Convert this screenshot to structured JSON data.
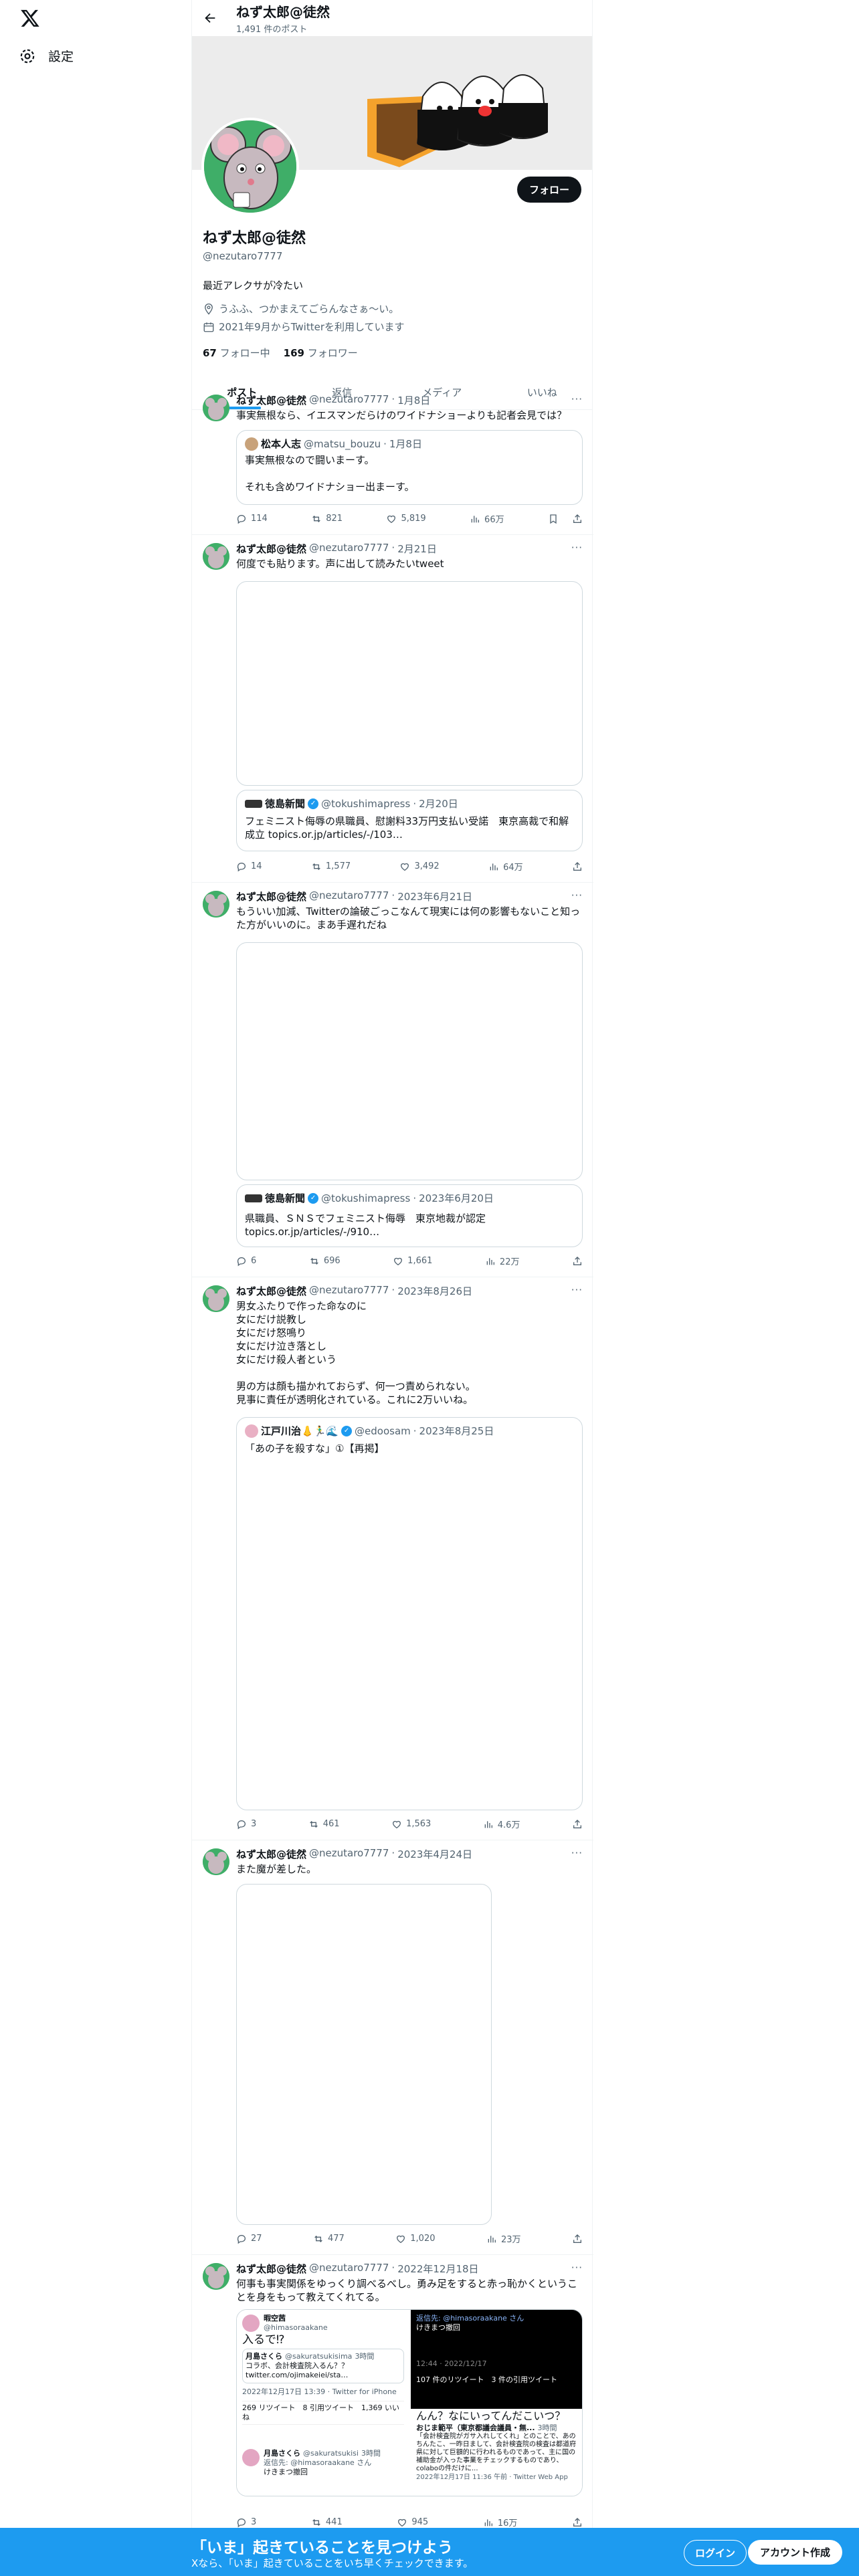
{
  "nav": {
    "settings_label": "設定"
  },
  "topbar": {
    "name": "ねず太郎@徒然",
    "post_count": "1,491 件のポスト"
  },
  "profile": {
    "follow_button": "フォロー",
    "name": "ねず太郎@徒然",
    "handle": "@nezutaro7777",
    "bio": "最近アレクサが冷たい",
    "location": "うふふ、つかまえてごらんなさぁ〜い。",
    "joined": "2021年9月からTwitterを利用しています",
    "following_count": "67",
    "following_label": "フォロー中",
    "followers_count": "169",
    "followers_label": "フォロワー"
  },
  "tabs": [
    "ポスト",
    "返信",
    "メディア",
    "いいね"
  ],
  "tweets": [
    {
      "name": "ねず太郎@徒然",
      "handle": "@nezutaro7777",
      "date": "1月8日",
      "text": "事実無根なら、イエスマンだらけのワイドナショーよりも記者会見では？",
      "quote": {
        "name": "松本人志",
        "handle": "@matsu_bouzu",
        "date": "1月8日",
        "text": "事実無根なので闘いまーす。\n\nそれも含めワイドナショー出まーす。"
      },
      "replies": "114",
      "retweets": "821",
      "likes": "5,819",
      "views": "66万"
    },
    {
      "name": "ねず太郎@徒然",
      "handle": "@nezutaro7777",
      "date": "2月21日",
      "text": "何度でも貼ります。声に出して読みたいtweet",
      "quote": {
        "name": "徳島新聞",
        "handle": "@tokushimapress",
        "date": "2月20日",
        "text": "フェミニスト侮辱の県職員、慰謝料33万円支払い受諾　東京高裁で和解成立 topics.or.jp/articles/-/103…"
      },
      "replies": "14",
      "retweets": "1,577",
      "likes": "3,492",
      "views": "64万"
    },
    {
      "name": "ねず太郎@徒然",
      "handle": "@nezutaro7777",
      "date": "2023年6月21日",
      "text": "もういい加減、Twitterの論破ごっこなんて現実には何の影響もないこと知った方がいいのに。まあ手遅れだね",
      "quote": {
        "name": "徳島新聞",
        "handle": "@tokushimapress",
        "date": "2023年6月20日",
        "text": "県職員、ＳＮＳでフェミニスト侮辱　東京地裁が認定\ntopics.or.jp/articles/-/910…"
      },
      "replies": "6",
      "retweets": "696",
      "likes": "1,661",
      "views": "22万"
    },
    {
      "name": "ねず太郎@徒然",
      "handle": "@nezutaro7777",
      "date": "2023年8月26日",
      "text": "男女ふたりで作った命なのに\n女にだけ説教し\n女にだけ怒鳴り\n女にだけ泣き落とし\n女にだけ殺人者という\n\n男の方は顔も描かれておらず、何一つ責められない。\n見事に責任が透明化されている。これに2万いいね。",
      "quote": {
        "name": "江戸川治👃🏃‍♂️🌊",
        "handle": "@edoosam",
        "date": "2023年8月25日",
        "text": "「あの子を殺すな」①【再掲】"
      },
      "replies": "3",
      "retweets": "461",
      "likes": "1,563",
      "views": "4.6万"
    },
    {
      "name": "ねず太郎@徒然",
      "handle": "@nezutaro7777",
      "date": "2023年4月24日",
      "text": "また魔が差した。",
      "replies": "27",
      "retweets": "477",
      "likes": "1,020",
      "views": "23万"
    },
    {
      "name": "ねず太郎@徒然",
      "handle": "@nezutaro7777",
      "date": "2022年12月18日",
      "text": "何事も事実関係をゆっくり調べるべし。勇み足をすると赤っ恥かくということを身をもって教えてくれてる。",
      "replies": "3",
      "retweets": "441",
      "likes": "945",
      "views": "16万"
    }
  ],
  "embedded_shot": {
    "left_user": "暇空茜",
    "left_handle": "@himasoraakane",
    "left_text": "入るで⁉",
    "inner_name": "月島さくら",
    "inner_handle": "@sakuratsukisima",
    "inner_age": "3時間",
    "inner_text": "コラボ、会計検査院入るん？？ twitter.com/ojimakeiei/sta…",
    "timestamp": "2022年12月17日 13:39 · Twitter for iPhone",
    "stats": "269 リツイート　8 引用ツイート　1,369 いいね",
    "reply_name": "月島さくら",
    "reply_handle": "@sakuratsukisi",
    "reply_age": "3時間",
    "reply_to": "返信先: @himasoraakane さん",
    "reply_text": "けきまつ撤回",
    "right_reply": "返信先: @himasoraakane さん",
    "right_text": "けきまつ撤回",
    "right_time": "12:44 · 2022/12/17",
    "right_stats": "107 件のリツイート　3 件の引用ツイート",
    "right_caption": "んん？なにいってんだこいつ？",
    "right_user": "おじま範平（東京都議会議員・無...",
    "right_user_age": "3時間",
    "right_body": "「会計検査院がガサ入れしてくれ」とのことで、あのちんたこ、一昨日まして、会計検査院の検査は都道府県に対して巨額的に行われるものであって、主に国の補助金が入った事業をチェックするものであり、colaboの件だけに...",
    "right_footer": "2022年12月17日 11:36 午前 · Twitter Web App"
  },
  "bottom_bar": {
    "title": "「いま」起きていることを見つけよう",
    "subtitle": "Xなら、「いま」起きていることをいち早くチェックできます。",
    "login": "ログイン",
    "signup": "アカウント作成"
  }
}
